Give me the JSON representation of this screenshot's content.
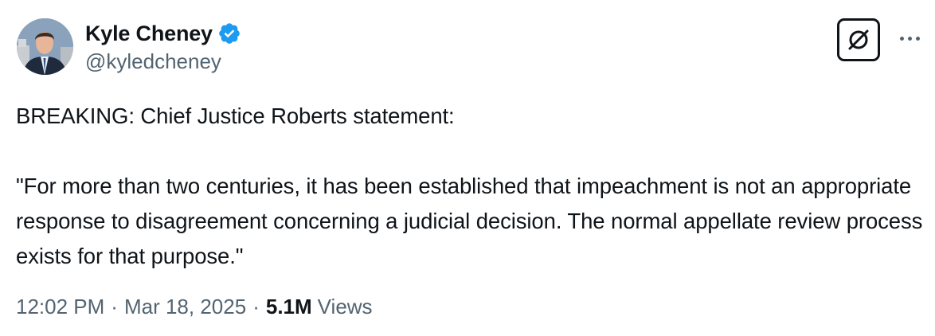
{
  "author": {
    "display_name": "Kyle Cheney",
    "handle": "@kyledcheney",
    "verified": true
  },
  "header_actions": {
    "grok_icon": "slashed-circle-icon",
    "more_icon": "ellipsis-icon"
  },
  "tweet": {
    "line_1": "BREAKING: Chief Justice Roberts statement:",
    "line_2": "\"For more than two centuries, it has been established that impeachment is not an appropriate response to disagreement concerning a judicial decision. The normal appellate review process exists for that purpose.\""
  },
  "meta": {
    "time": "12:02 PM",
    "date": "Mar 18, 2025",
    "separator": "·",
    "views_count": "5.1M",
    "views_label": "Views"
  },
  "colors": {
    "text_primary": "#0f1419",
    "text_secondary": "#536471",
    "verified_blue": "#1d9bf0"
  }
}
